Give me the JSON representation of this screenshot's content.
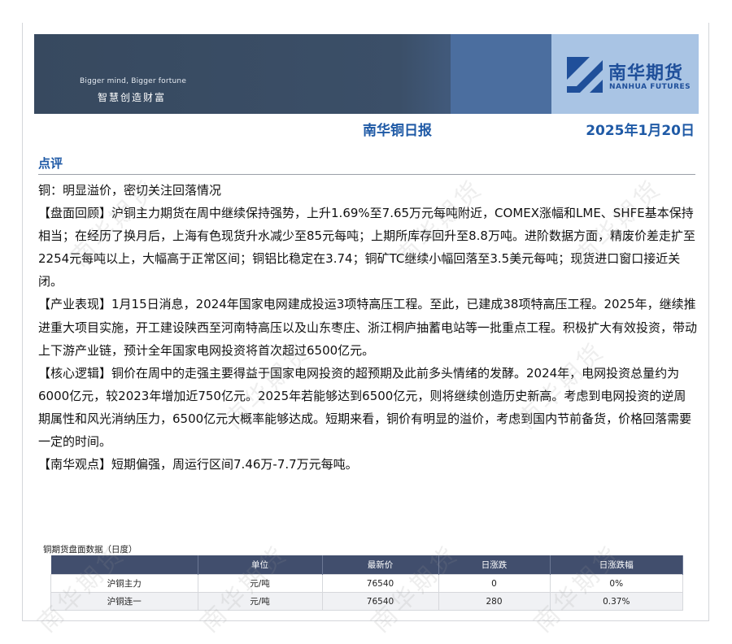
{
  "banner": {
    "slogan_en": "Bigger mind, Bigger fortune",
    "slogan_cn": "智慧创造财富",
    "logo_cn": "南华期货",
    "logo_en": "NANHUA FUTURES"
  },
  "report": {
    "title": "南华铜日报",
    "date": "2025年1月20日"
  },
  "section": {
    "heading": "点评",
    "paragraphs": [
      "铜：明显溢价，密切关注回落情况",
      "【盘面回顾】沪铜主力期货在周中继续保持强势，上升1.69%至7.65万元每吨附近，COMEX涨幅和LME、SHFE基本保持相当；在经历了换月后，上海有色现货升水减少至85元每吨；上期所库存回升至8.8万吨。进阶数据方面，精废价差走扩至2254元每吨以上，大幅高于正常区间；铜铝比稳定在3.74；铜矿TC继续小幅回落至3.5美元每吨；现货进口窗口接近关闭。",
      "【产业表现】1月15日消息，2024年国家电网建成投运3项特高压工程。至此，已建成38项特高压工程。2025年，继续推进重大项目实施，开工建设陕西至河南特高压以及山东枣庄、浙江桐庐抽蓄电站等一批重点工程。积极扩大有效投资，带动上下游产业链，预计全年国家电网投资将首次超过6500亿元。",
      "【核心逻辑】铜价在周中的走强主要得益于国家电网投资的超预期及此前多头情绪的发酵。2024年，电网投资总量约为6000亿元，较2023年增加近750亿元。2025年若能够达到6500亿元，则将继续创造历史新高。考虑到电网投资的逆周期属性和风光消纳压力，6500亿元大概率能够达成。短期来看，铜价有明显的溢价，考虑到国内节前备货，价格回落需要一定的时间。",
      "【南华观点】短期偏强，周运行区间7.46万-7.7万元每吨。"
    ]
  },
  "table": {
    "caption": "铜期货盘面数据（日度）",
    "headers": [
      "",
      "单位",
      "最新价",
      "日涨跌",
      "日涨跌幅"
    ],
    "rows": [
      [
        "沪铜主力",
        "元/吨",
        "76540",
        "0",
        "0%"
      ],
      [
        "沪铜连一",
        "元/吨",
        "76540",
        "280",
        "0.37%"
      ]
    ]
  },
  "watermark": "南华期货",
  "colors": {
    "brand_blue": "#1f5aa6",
    "banner_dark": "#37495f",
    "table_header": "#414e6d"
  }
}
